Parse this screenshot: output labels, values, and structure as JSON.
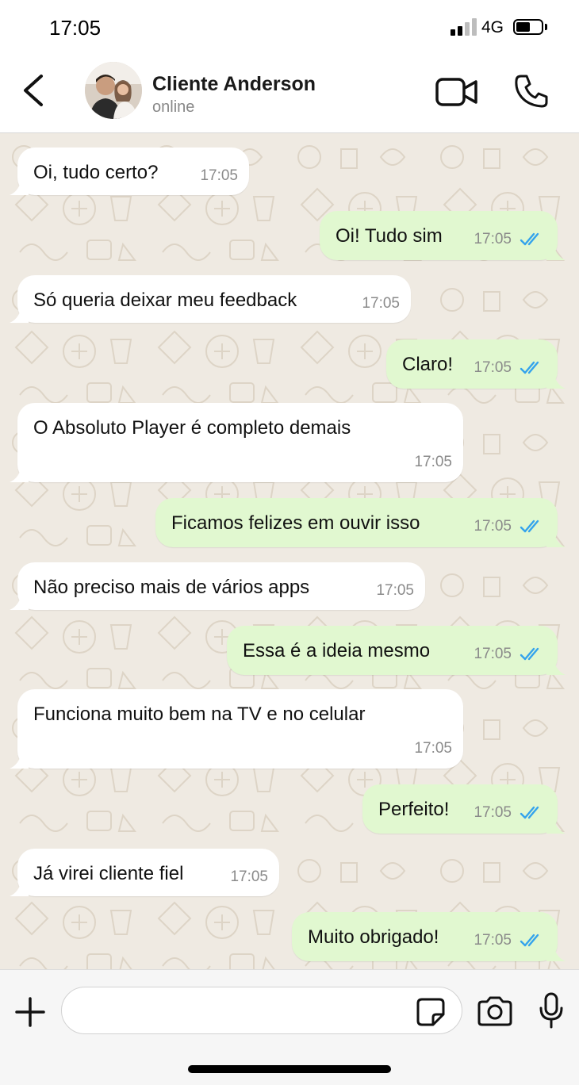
{
  "status_bar": {
    "time": "17:05",
    "network": "4G",
    "battery_fraction": 0.55
  },
  "header": {
    "contact_name": "Cliente Anderson",
    "contact_status": "online"
  },
  "colors": {
    "incoming_bubble": "#ffffff",
    "outgoing_bubble": "#e1f8d0",
    "chat_background": "#efeae2",
    "read_ticks": "#34a3ec",
    "timestamp": "#8a8a8a"
  },
  "messages": [
    {
      "direction": "in",
      "text": "Oi, tudo certo?",
      "time": "17:05"
    },
    {
      "direction": "out",
      "text": "Oi! Tudo sim",
      "time": "17:05",
      "status": "read"
    },
    {
      "direction": "in",
      "text": "Só queria deixar meu feedback",
      "time": "17:05"
    },
    {
      "direction": "out",
      "text": "Claro!",
      "time": "17:05",
      "status": "read"
    },
    {
      "direction": "in",
      "text": "O Absoluto Player é completo demais",
      "time": "17:05"
    },
    {
      "direction": "out",
      "text": "Ficamos felizes em ouvir isso",
      "time": "17:05",
      "status": "read"
    },
    {
      "direction": "in",
      "text": "Não preciso mais de vários apps",
      "time": "17:05"
    },
    {
      "direction": "out",
      "text": "Essa é a ideia mesmo",
      "time": "17:05",
      "status": "read"
    },
    {
      "direction": "in",
      "text": "Funciona muito bem na TV e no celular",
      "time": "17:05"
    },
    {
      "direction": "out",
      "text": "Perfeito!",
      "time": "17:05",
      "status": "read"
    },
    {
      "direction": "in",
      "text": "Já virei cliente fiel",
      "time": "17:05"
    },
    {
      "direction": "out",
      "text": "Muito obrigado!",
      "time": "17:05",
      "status": "read"
    }
  ],
  "composer": {
    "input_value": "",
    "input_placeholder": ""
  },
  "icons": {
    "back": "chevron-left-icon",
    "video": "video-camera-icon",
    "call": "phone-icon",
    "attach": "plus-icon",
    "sticker": "sticker-icon",
    "camera": "camera-icon",
    "mic": "microphone-icon"
  }
}
